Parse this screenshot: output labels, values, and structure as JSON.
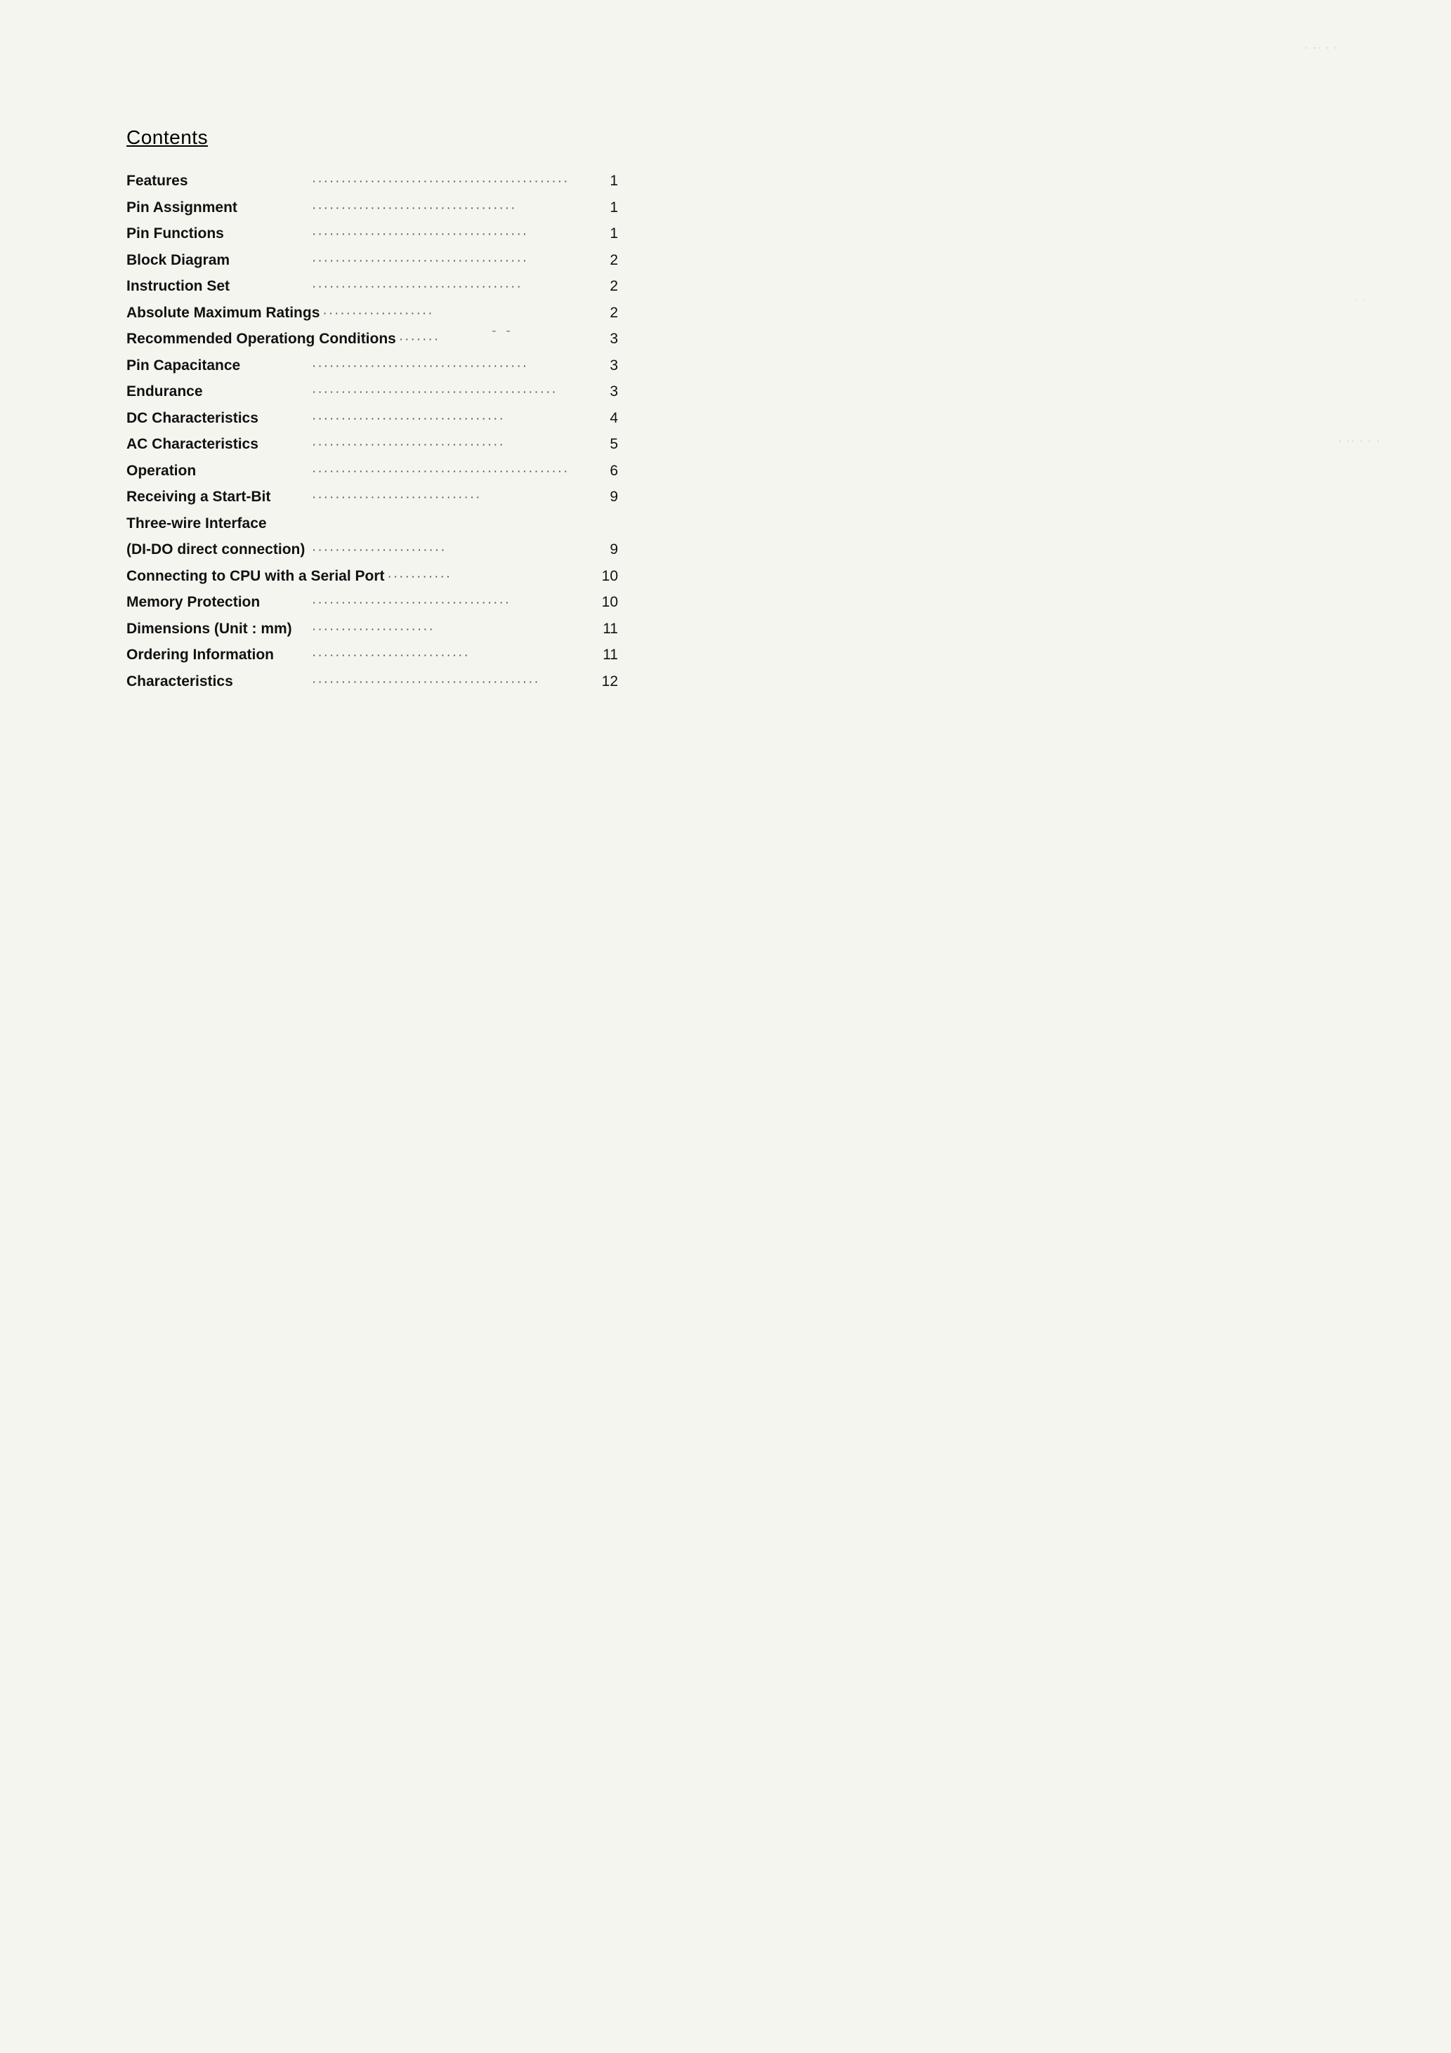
{
  "heading": "Contents",
  "toc": [
    {
      "label": "Features",
      "dots": "············································",
      "page": "1"
    },
    {
      "label": "Pin Assignment",
      "dots": "···································",
      "page": "1"
    },
    {
      "label": "Pin Functions",
      "dots": "·····································",
      "page": "1"
    },
    {
      "label": "Block Diagram",
      "dots": "·····································",
      "page": "2"
    },
    {
      "label": "Instruction Set",
      "dots": "····································",
      "page": "2"
    },
    {
      "label": "Absolute Maximum Ratings",
      "dots": "···················",
      "page": "2"
    },
    {
      "label": "Recommended Operationg Conditions",
      "dots": "·······",
      "page": "3"
    },
    {
      "label": "Pin Capacitance",
      "dots": "·····································",
      "page": "3"
    },
    {
      "label": "Endurance",
      "dots": "··········································",
      "page": "3"
    },
    {
      "label": "DC Characteristics",
      "dots": "·································",
      "page": "4"
    },
    {
      "label": "AC Characteristics",
      "dots": "·································",
      "page": "5"
    },
    {
      "label": "Operation",
      "dots": "············································",
      "page": "6"
    },
    {
      "label": "Receiving a Start-Bit",
      "dots": "·····························",
      "page": "9"
    },
    {
      "label": "Three-wire Interface",
      "dots": "",
      "page": ""
    },
    {
      "label": "(DI-DO direct connection)",
      "dots": "·······················",
      "page": "9"
    },
    {
      "label": "Connecting to CPU with a Serial Port",
      "dots": "···········",
      "page": "10"
    },
    {
      "label": "Memory Protection",
      "dots": "··································",
      "page": "10"
    },
    {
      "label": "Dimensions (Unit : mm)",
      "dots": "·····················",
      "page": "11"
    },
    {
      "label": "Ordering Information",
      "dots": "···························",
      "page": "11"
    },
    {
      "label": "Characteristics",
      "dots": "·······································",
      "page": "12"
    }
  ]
}
